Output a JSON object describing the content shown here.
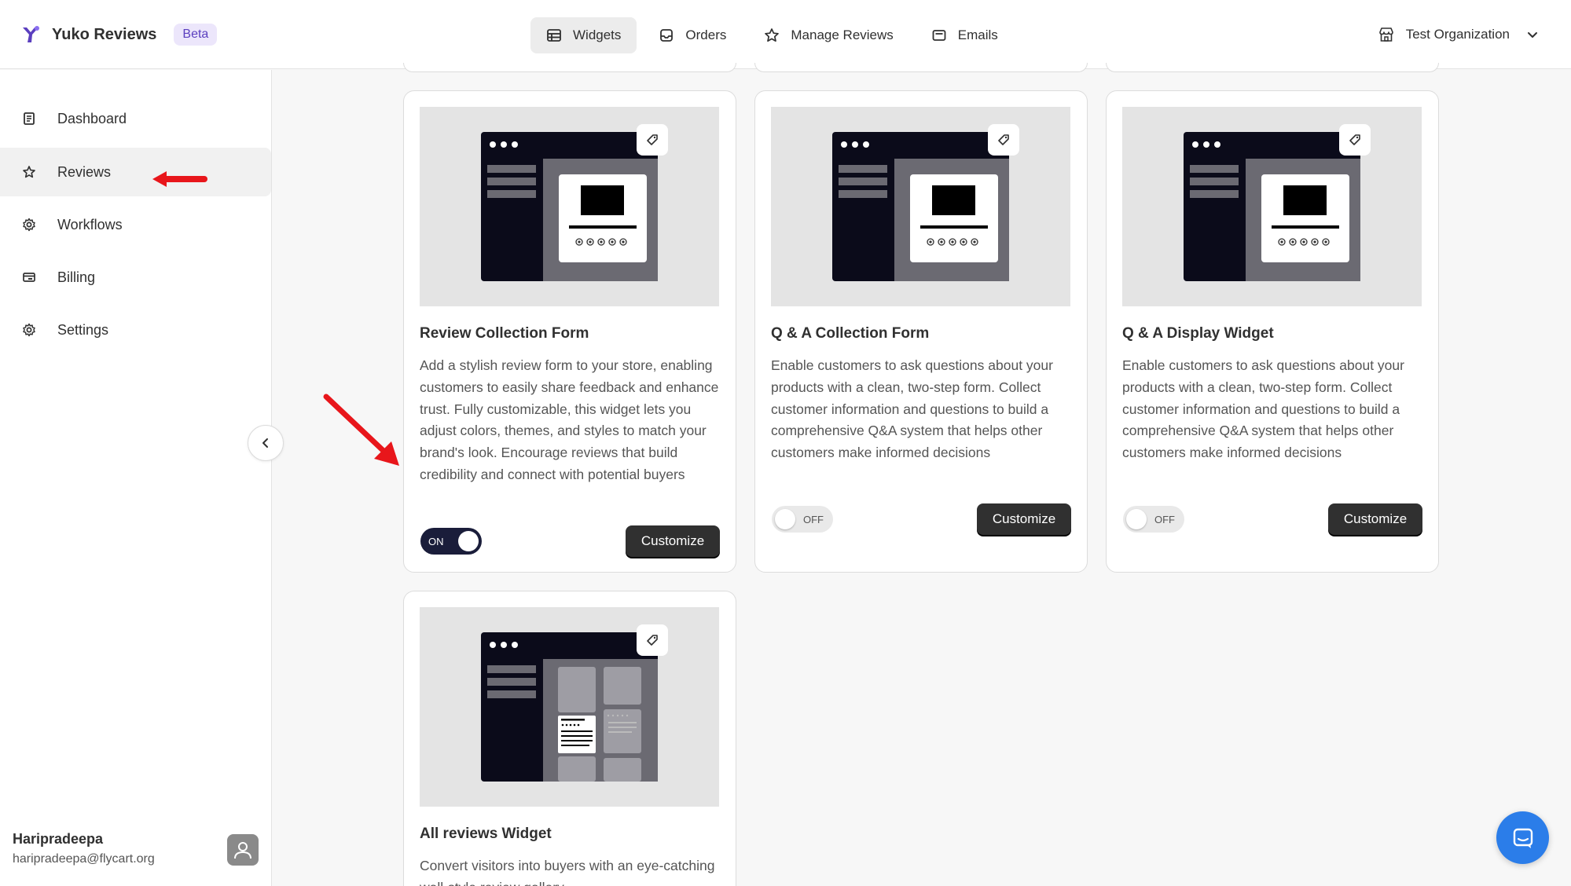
{
  "app": {
    "name": "Yuko Reviews",
    "badge": "Beta"
  },
  "topnav": [
    {
      "label": "Widgets",
      "icon": "widgets-icon",
      "active": true
    },
    {
      "label": "Orders",
      "icon": "inbox-icon"
    },
    {
      "label": "Manage Reviews",
      "icon": "star-icon"
    },
    {
      "label": "Emails",
      "icon": "email-icon"
    }
  ],
  "org": {
    "name": "Test Organization"
  },
  "sidebar": {
    "items": [
      {
        "label": "Dashboard",
        "icon": "dashboard-icon"
      },
      {
        "label": "Reviews",
        "icon": "star-icon",
        "active": true
      },
      {
        "label": "Workflows",
        "icon": "gear-icon"
      },
      {
        "label": "Billing",
        "icon": "billing-icon"
      },
      {
        "label": "Settings",
        "icon": "gear-icon"
      }
    ]
  },
  "user": {
    "name": "Haripradeepa",
    "email": "haripradeepa@flycart.org"
  },
  "cards": [
    {
      "title": "Review Collection Form",
      "description": "Add a stylish review form to your store, enabling customers to easily share feedback and enhance trust. Fully customizable, this widget lets you adjust colors, themes, and styles to match your brand's look. Encourage reviews that build credibility and connect with potential buyers",
      "toggle": "ON",
      "button": "Customize"
    },
    {
      "title": "Q & A Collection Form",
      "description": "Enable customers to ask questions about your products with a clean, two-step form. Collect customer information and questions to build a comprehensive Q&A system that helps other customers make informed decisions",
      "toggle": "OFF",
      "button": "Customize"
    },
    {
      "title": "Q & A Display Widget",
      "description": "Enable customers to ask questions about your products with a clean, two-step form. Collect customer information and questions to build a comprehensive Q&A system that helps other customers make informed decisions",
      "toggle": "OFF",
      "button": "Customize"
    },
    {
      "title": "All reviews Widget",
      "description": "Convert visitors into buyers with an eye-catching wall-style review gallery"
    }
  ],
  "colors": {
    "accent": "#5b3fbf",
    "toggle_on": "#1a1d3a",
    "chat": "#2b7de9",
    "annotation_arrow": "#e8161b"
  }
}
